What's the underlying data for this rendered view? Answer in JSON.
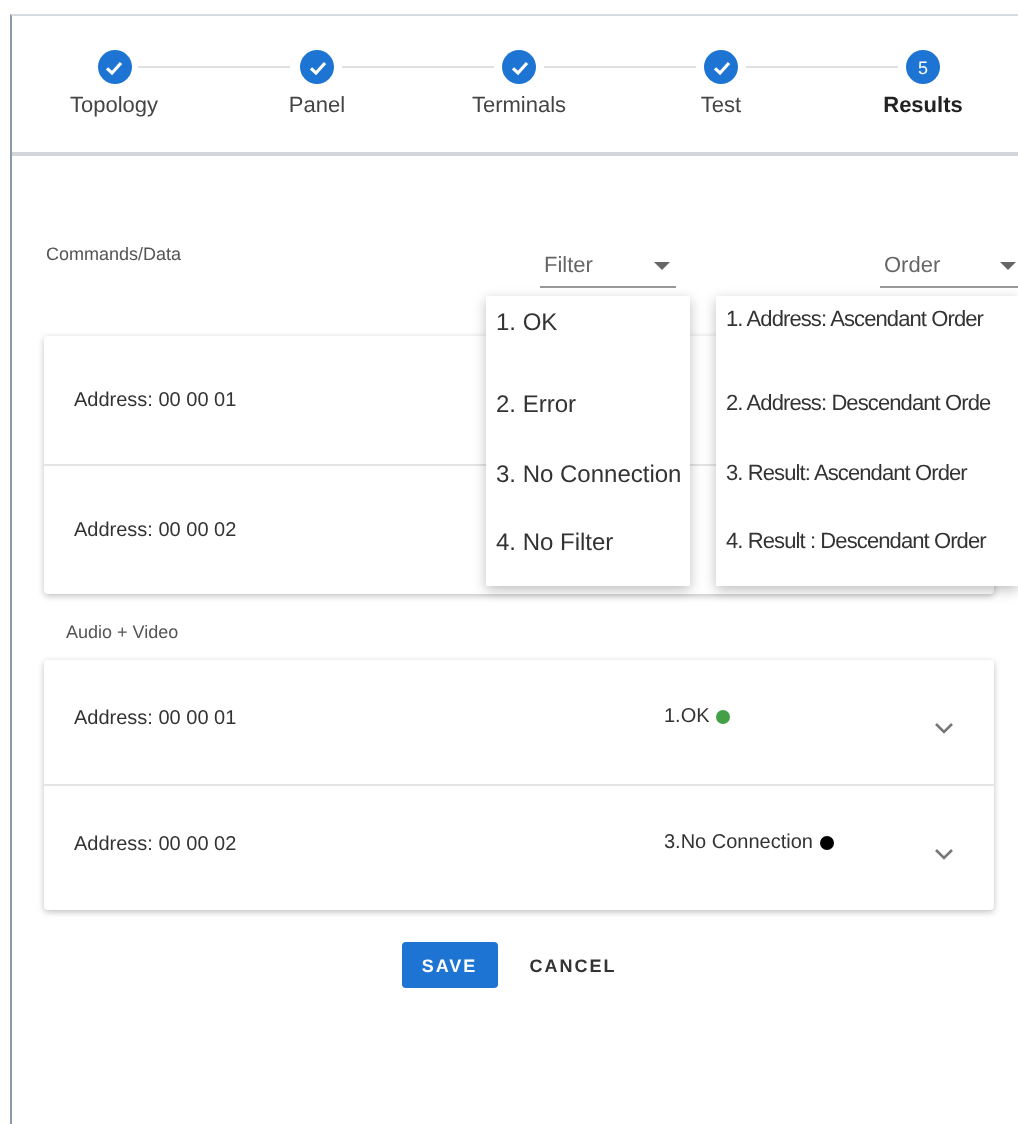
{
  "stepper": [
    {
      "label": "Topology",
      "completed": true,
      "active": false
    },
    {
      "label": "Panel",
      "completed": true,
      "active": false
    },
    {
      "label": "Terminals",
      "completed": true,
      "active": false
    },
    {
      "label": "Test",
      "completed": true,
      "active": false
    },
    {
      "label": "Results",
      "completed": false,
      "active": true,
      "number": "5"
    }
  ],
  "sections": [
    {
      "title": "Commands/Data",
      "filter": {
        "label": "Filter"
      },
      "order": {
        "label": "Order"
      },
      "rows": [
        {
          "address": "Address: 00 00 01"
        },
        {
          "address": "Address: 00 00 02"
        }
      ]
    },
    {
      "title": "Audio + Video",
      "rows": [
        {
          "address": "Address: 00 00 01",
          "status": "1.OK",
          "color": "#43a047"
        },
        {
          "address": "Address: 00 00 02",
          "status": "3.No Connection",
          "color": "#000000"
        }
      ]
    }
  ],
  "filter_menu": [
    "1. OK",
    "2. Error",
    "3. No Connection",
    "4. No Filter"
  ],
  "order_menu": [
    "1. Address: Ascendant Order",
    "2. Address: Descendant Orde",
    "3. Result: Ascendant Order",
    "4. Result : Descendant Order"
  ],
  "buttons": [
    {
      "label": "SAVE",
      "kind": "primary"
    },
    {
      "label": "CANCEL",
      "kind": "text"
    }
  ]
}
